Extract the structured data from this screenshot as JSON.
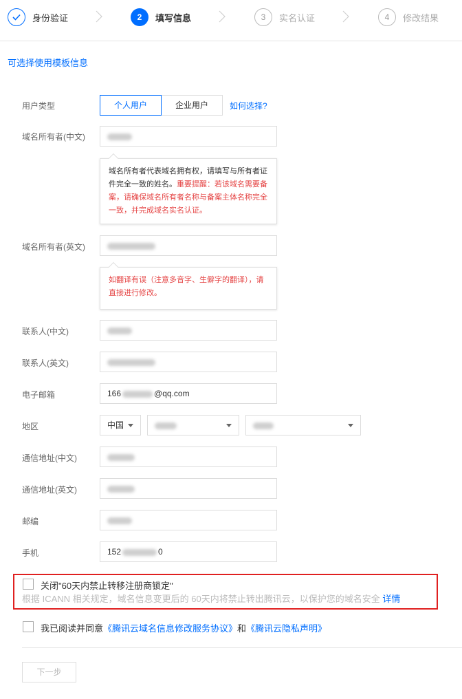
{
  "steps": [
    {
      "num": "✓",
      "label": "身份验证",
      "state": "done"
    },
    {
      "num": "2",
      "label": "填写信息",
      "state": "active"
    },
    {
      "num": "3",
      "label": "实名认证",
      "state": "todo"
    },
    {
      "num": "4",
      "label": "修改结果",
      "state": "todo"
    }
  ],
  "template_link": "可选择使用模板信息",
  "user_type": {
    "label": "用户类型",
    "options": [
      "个人用户",
      "企业用户"
    ],
    "selected": "个人用户",
    "help": "如何选择?"
  },
  "owner_cn": {
    "label": "域名所有者(中文)",
    "tip_dark": "域名所有者代表域名拥有权，请填写与所有者证件完全一致的姓名。",
    "tip_red": "重要提醒：若该域名需要备案，请确保域名所有者名称与备案主体名称完全一致，并完成域名实名认证。"
  },
  "owner_en": {
    "label": "域名所有者(英文)",
    "tip_red": "如翻译有误（注意多音字、生僻字的翻译），请直接进行修改。"
  },
  "contact_cn": {
    "label": "联系人(中文)"
  },
  "contact_en": {
    "label": "联系人(英文)"
  },
  "email": {
    "label": "电子邮箱",
    "value_start": "166",
    "value_end": "@qq.com"
  },
  "region": {
    "label": "地区",
    "country": "中国"
  },
  "address_cn": {
    "label": "通信地址(中文)"
  },
  "address_en": {
    "label": "通信地址(英文)"
  },
  "postcode": {
    "label": "邮编"
  },
  "phone": {
    "label": "手机",
    "value_start": "152",
    "value_end": "0"
  },
  "lock": {
    "label": "关闭\"60天内禁止转移注册商锁定\"",
    "notice": "根据 ICANN 相关规定，域名信息变更后的 60天内将禁止转出腾讯云，以保护您的域名安全",
    "details": "详情"
  },
  "agree": {
    "prefix": "我已阅读并同意",
    "agreement": "《腾讯云域名信息修改服务协议》",
    "and": "和",
    "privacy": "《腾讯云隐私声明》"
  },
  "next_button": "下一步",
  "colors": {
    "accent": "#006eff",
    "warning": "#e54545",
    "highlight_border": "#e02020"
  }
}
